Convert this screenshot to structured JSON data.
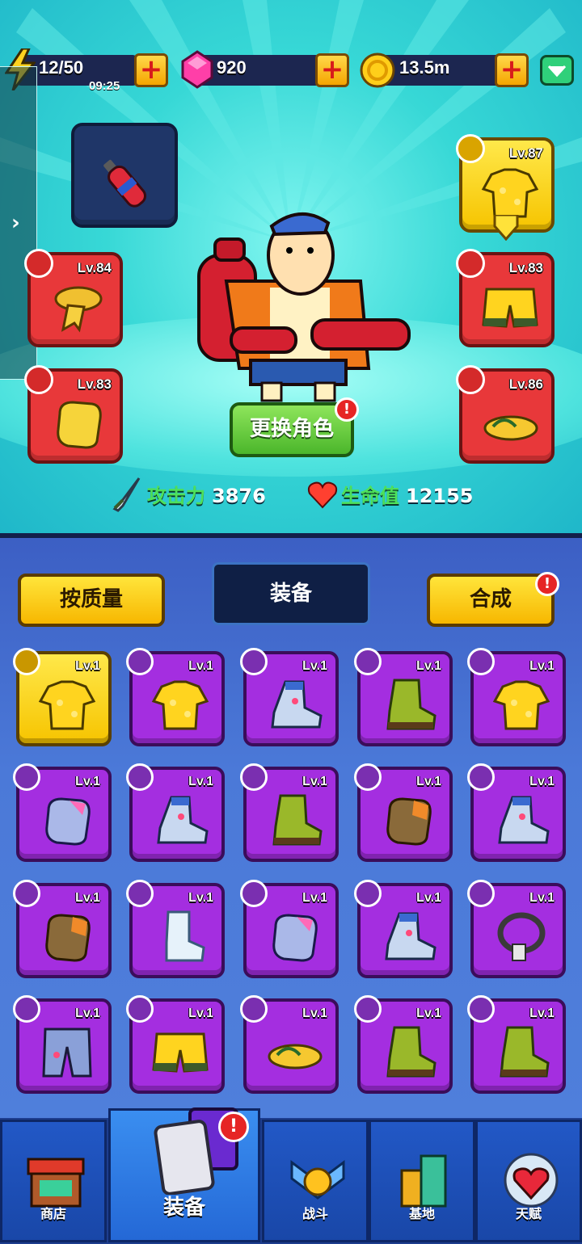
{
  "resources": {
    "energy": "12/50",
    "energy_timer": "09:25",
    "gems": "920",
    "coins": "13.5m",
    "plus": "+"
  },
  "hero": {
    "change_character": "更换角色",
    "alert": "!",
    "attack_label": "攻击力",
    "attack_value": "3876",
    "hp_label": "生命值",
    "hp_value": "12155",
    "drawer_arrow": "›",
    "slots": {
      "shirt": "Lv.87",
      "necklace": "Lv.84",
      "shorts": "Lv.83",
      "glove": "Lv.83",
      "shoes": "Lv.86"
    }
  },
  "inventory": {
    "sort_button": "按质量",
    "tab": "装备",
    "merge_button": "合成",
    "merge_alert": "!",
    "items": [
      {
        "type": "shirt",
        "rarity": "gold",
        "lv": "Lv.1"
      },
      {
        "type": "shirt",
        "rarity": "purple",
        "lv": "Lv.1"
      },
      {
        "type": "shoe-blue",
        "rarity": "purple",
        "lv": "Lv.1"
      },
      {
        "type": "boot-green",
        "rarity": "purple",
        "lv": "Lv.1"
      },
      {
        "type": "shirt",
        "rarity": "purple",
        "lv": "Lv.1"
      },
      {
        "type": "glove-blue",
        "rarity": "purple",
        "lv": "Lv.1"
      },
      {
        "type": "shoe-blue",
        "rarity": "purple",
        "lv": "Lv.1"
      },
      {
        "type": "boot-green",
        "rarity": "purple",
        "lv": "Lv.1"
      },
      {
        "type": "glove-orange",
        "rarity": "purple",
        "lv": "Lv.1"
      },
      {
        "type": "shoe-blue",
        "rarity": "purple",
        "lv": "Lv.1"
      },
      {
        "type": "glove-orange",
        "rarity": "purple",
        "lv": "Lv.1"
      },
      {
        "type": "sock",
        "rarity": "purple",
        "lv": "Lv.1"
      },
      {
        "type": "glove-blue",
        "rarity": "purple",
        "lv": "Lv.1"
      },
      {
        "type": "shoe-blue",
        "rarity": "purple",
        "lv": "Lv.1"
      },
      {
        "type": "necklace",
        "rarity": "purple",
        "lv": "Lv.1"
      },
      {
        "type": "pants-blue",
        "rarity": "purple",
        "lv": "Lv.1"
      },
      {
        "type": "shorts",
        "rarity": "purple",
        "lv": "Lv.1"
      },
      {
        "type": "flipflop",
        "rarity": "purple",
        "lv": "Lv.1"
      },
      {
        "type": "boot-green",
        "rarity": "purple",
        "lv": "Lv.1"
      },
      {
        "type": "boot-green",
        "rarity": "purple",
        "lv": "Lv.1"
      }
    ]
  },
  "nav": {
    "shop": "商店",
    "equipment": "装备",
    "battle": "战斗",
    "base": "基地",
    "talent": "天赋",
    "equipment_alert": "!"
  },
  "colors": {
    "accent_yellow": "#f7c400",
    "rarity_purple": "#a42ee0",
    "slot_red": "#e8383a",
    "stat_green": "#4ee05a"
  }
}
